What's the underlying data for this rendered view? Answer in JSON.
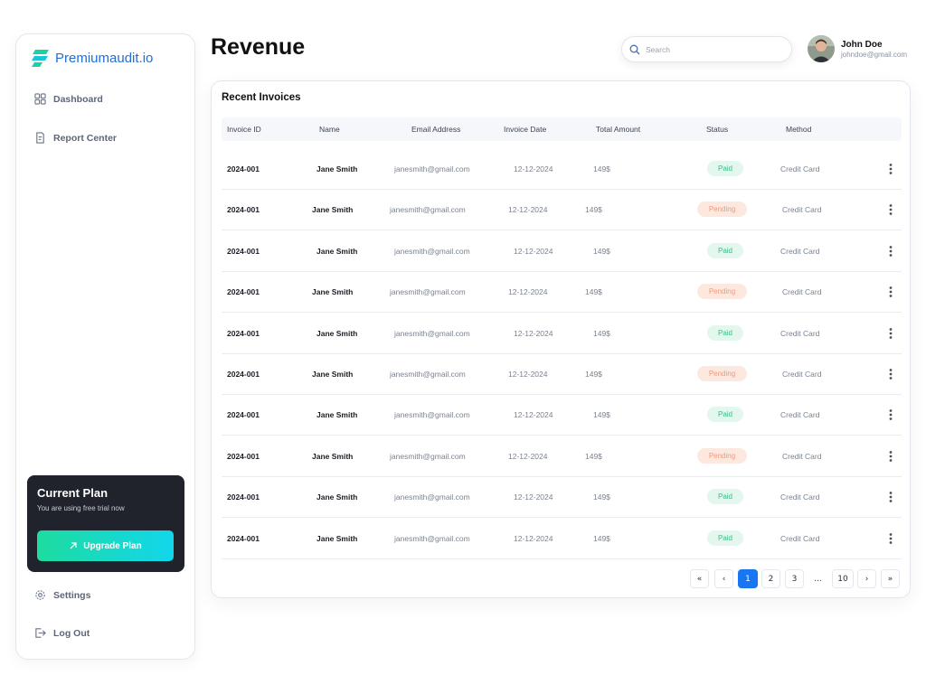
{
  "brand": {
    "name": "Premiumaudit.io",
    "logo_color": "#1fd9c7"
  },
  "sidebar": {
    "items": [
      {
        "label": "Dashboard",
        "icon": "grid-icon"
      },
      {
        "label": "Report Center",
        "icon": "report-icon"
      }
    ],
    "bottom_items": [
      {
        "label": "Settings",
        "icon": "gear-icon"
      },
      {
        "label": "Log Out",
        "icon": "logout-icon"
      }
    ]
  },
  "plan": {
    "title": "Current Plan",
    "subtitle": "You are using free trial now",
    "button_label": "Upgrade Plan",
    "button_icon": "arrow-up-right-icon"
  },
  "header": {
    "title": "Revenue",
    "search_placeholder": "Search"
  },
  "user": {
    "name": "John Doe",
    "email": "johndoe@gmail.com"
  },
  "invoices": {
    "title": "Recent Invoices",
    "columns": [
      "Invoice ID",
      "Name",
      "Email Address",
      "Invoice Date",
      "Total Amount",
      "Status",
      "Method"
    ],
    "rows": [
      {
        "id": "2024-001",
        "name": "Jane Smith",
        "email": "janesmith@gmail.com",
        "date": "12-12-2024",
        "amount": "149$",
        "status": "Paid",
        "method": "Credit Card"
      },
      {
        "id": "2024-001",
        "name": "Jane Smith",
        "email": "janesmith@gmail.com",
        "date": "12-12-2024",
        "amount": "149$",
        "status": "Pending",
        "method": "Credit Card"
      },
      {
        "id": "2024-001",
        "name": "Jane Smith",
        "email": "janesmith@gmail.com",
        "date": "12-12-2024",
        "amount": "149$",
        "status": "Paid",
        "method": "Credit Card"
      },
      {
        "id": "2024-001",
        "name": "Jane Smith",
        "email": "janesmith@gmail.com",
        "date": "12-12-2024",
        "amount": "149$",
        "status": "Pending",
        "method": "Credit Card"
      },
      {
        "id": "2024-001",
        "name": "Jane Smith",
        "email": "janesmith@gmail.com",
        "date": "12-12-2024",
        "amount": "149$",
        "status": "Paid",
        "method": "Credit Card"
      },
      {
        "id": "2024-001",
        "name": "Jane Smith",
        "email": "janesmith@gmail.com",
        "date": "12-12-2024",
        "amount": "149$",
        "status": "Pending",
        "method": "Credit Card"
      },
      {
        "id": "2024-001",
        "name": "Jane Smith",
        "email": "janesmith@gmail.com",
        "date": "12-12-2024",
        "amount": "149$",
        "status": "Paid",
        "method": "Credit Card"
      },
      {
        "id": "2024-001",
        "name": "Jane Smith",
        "email": "janesmith@gmail.com",
        "date": "12-12-2024",
        "amount": "149$",
        "status": "Pending",
        "method": "Credit Card"
      },
      {
        "id": "2024-001",
        "name": "Jane Smith",
        "email": "janesmith@gmail.com",
        "date": "12-12-2024",
        "amount": "149$",
        "status": "Paid",
        "method": "Credit Card"
      },
      {
        "id": "2024-001",
        "name": "Jane Smith",
        "email": "janesmith@gmail.com",
        "date": "12-12-2024",
        "amount": "149$",
        "status": "Paid",
        "method": "Credit Card"
      }
    ]
  },
  "pagination": {
    "first": "«",
    "prev": "‹",
    "pages": [
      "1",
      "2",
      "3"
    ],
    "ellipsis": "...",
    "last_page": "10",
    "next": "›",
    "last": "»",
    "current": "1",
    "active_color": "#1976f2"
  },
  "colors": {
    "paid_bg": "#e3f7ee",
    "paid_text": "#3bbd84",
    "pending_bg": "#fde8df",
    "pending_text": "#ef9a7a",
    "upgrade_gradient_start": "#1ddc9f",
    "upgrade_gradient_end": "#12d6ec",
    "plan_card_bg": "#20232b"
  }
}
